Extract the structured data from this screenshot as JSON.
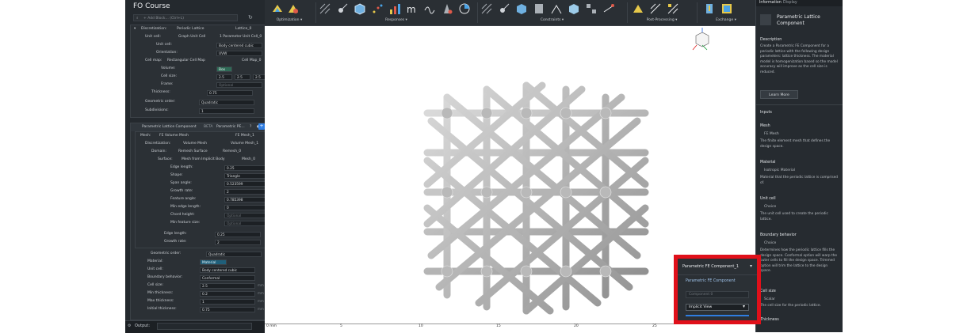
{
  "app": {
    "course_title": "FO Course",
    "search_placeholder": "+ Add Block... (Ctrl+L)"
  },
  "toolbar": {
    "groups": [
      {
        "label": "Optimization ▾"
      },
      {
        "label": "Responses ▾"
      },
      {
        "label": "Constraints ▾"
      },
      {
        "label": "Post-Processing ▾"
      },
      {
        "label": "Exchange ▾"
      }
    ]
  },
  "left_panel": {
    "block1": {
      "rows": [
        {
          "label": "Discretization:",
          "value": "Periodic Lattice",
          "tag": "Lattice_0"
        },
        {
          "label": "Unit cell:",
          "value": "Graph Unit Cell",
          "tag": "1 Parameter Unit Cell_0"
        },
        {
          "label": "Unit cell:",
          "value": "Body centered cubic"
        },
        {
          "label": "Orientation:",
          "value": "UVW"
        },
        {
          "label": "Cell map:",
          "value": "Rectangular Cell Map",
          "tag": "Cell Map_0"
        },
        {
          "label": "Volume:",
          "value": "Box"
        },
        {
          "label": "Cell size:",
          "v1": "2.5",
          "v2": "2.5",
          "v3": "2.5",
          "unit": "mm"
        },
        {
          "label": "Frame:",
          "value": "Optional"
        },
        {
          "label": "Thickness:",
          "value": "0.75"
        },
        {
          "label": "Geometric order:",
          "value": "Quadratic"
        },
        {
          "label": "Subdivisions:",
          "value": "1"
        }
      ]
    },
    "block2": {
      "header": "Parametric Lattice Component",
      "header_badge": "BETA",
      "header_tag": "Parametric PE...",
      "rows": [
        {
          "label": "Mesh:",
          "value": "FE Volume Mesh",
          "tag": "FE Mesh_1"
        },
        {
          "label": "Discretization:",
          "value": "Volume Mesh",
          "tag": "Volume Mesh_1"
        },
        {
          "label": "Domain:",
          "value": "Remesh Surface",
          "tag": "Remesh_0"
        },
        {
          "label": "Surface:",
          "value": "Mesh from Implicit Body",
          "tag": "Mesh_0"
        },
        {
          "label": "Edge length:",
          "value": "0.25",
          "unit": "mm"
        },
        {
          "label": "Shape:",
          "value": "Triangle"
        },
        {
          "label": "Span angle:",
          "value": "0.523599",
          "unit": "rad"
        },
        {
          "label": "Growth rate:",
          "value": "2"
        },
        {
          "label": "Feature angle:",
          "value": "0.785398",
          "unit": "rad"
        },
        {
          "label": "Min edge length:",
          "value": "0",
          "unit": "mm"
        },
        {
          "label": "Chord height:",
          "value": "Optional",
          "unit": "mm"
        },
        {
          "label": "Min feature size:",
          "value": "Optional",
          "unit": "mm"
        },
        {
          "label": "Edge length:",
          "value": "0.25",
          "unit": "mm"
        },
        {
          "label": "Growth rate:",
          "value": "2"
        },
        {
          "label": "Geometric order:",
          "value": "Quadratic"
        },
        {
          "label": "Material:",
          "value": "Material"
        },
        {
          "label": "Unit cell:",
          "value": "Body centered cubic"
        },
        {
          "label": "Boundary behavior:",
          "value": "Conformal"
        },
        {
          "label": "Cell size:",
          "value": "2.5",
          "unit": "mm"
        },
        {
          "label": "Min thickness:",
          "value": "0.2",
          "unit": "mm"
        },
        {
          "label": "Max thickness:",
          "value": "1",
          "unit": "mm"
        },
        {
          "label": "Initial thickness:",
          "value": "0.75",
          "unit": "mm"
        }
      ]
    },
    "output_label": "Output:"
  },
  "ruler": {
    "ticks": [
      "0 mm",
      "5",
      "10",
      "15",
      "20",
      "25"
    ]
  },
  "popup": {
    "title": "Parametric FE Component_1",
    "item1": "Parametric FE Component",
    "item2": "Component 0",
    "item3": "Implicit View"
  },
  "right_panel": {
    "tabs": [
      "Information",
      "Display"
    ],
    "title": "Parametric Lattice Component",
    "description_heading": "Description",
    "description": "Create a Parametric FE Component for a periodic lattice with the following design parameters: lattice thickness. The material model is homogenization based so the model accuracy will improve as the cell size is reduced.",
    "learn_more": "Learn More",
    "inputs_heading": "Inputs",
    "inputs": [
      {
        "name": "Mesh",
        "type": "FE Mesh",
        "desc": "The finite element mesh that defines the design space."
      },
      {
        "name": "Material",
        "type": "Isotropic Material",
        "desc": "Material that the periodic lattice is comprised of."
      },
      {
        "name": "Unit cell",
        "type": "Choice",
        "desc": "The unit cell used to create the periodic lattice."
      },
      {
        "name": "Boundary behavior",
        "type": "Choice",
        "desc": "Determines how the periodic lattice fills the design space. Conformal option will warp the outer cells to fill the design space. Trimmed option will trim the lattice to the design space."
      },
      {
        "name": "Cell size",
        "type": "Scalar",
        "desc": "The cell size for the periodic lattice."
      },
      {
        "name": "Thickness",
        "type": "Scalar",
        "desc": ""
      }
    ]
  }
}
